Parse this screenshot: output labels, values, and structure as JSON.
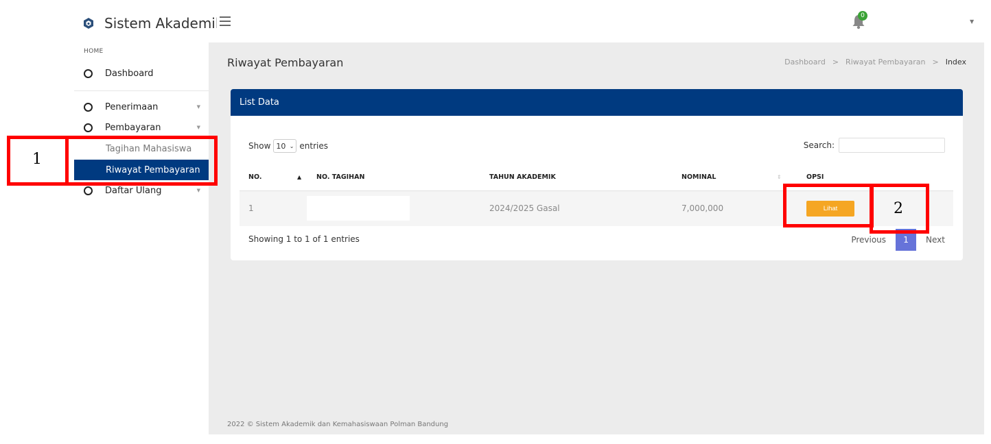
{
  "header": {
    "brand": "Sistem Akademik",
    "notification_count": "0",
    "colors": {
      "brand_blue": "#003a80",
      "badge_green": "#3aa335"
    }
  },
  "sidebar": {
    "section": "HOME",
    "dashboard": "Dashboard",
    "penerimaan": "Penerimaan",
    "pembayaran": "Pembayaran",
    "sub_tagihan": "Tagihan Mahasiswa",
    "sub_riwayat": "Riwayat Pembayaran",
    "daftar_ulang": "Daftar Ulang"
  },
  "page": {
    "title": "Riwayat Pembayaran",
    "breadcrumb": [
      "Dashboard",
      "Riwayat Pembayaran",
      "Index"
    ]
  },
  "card": {
    "title": "List Data",
    "show": "Show",
    "length": "10",
    "entries": "entries",
    "search_label": "Search:",
    "search_value": "",
    "columns": [
      "NO.",
      "NO. TAGIHAN",
      "TAHUN AKADEMIK",
      "NOMINAL",
      "OPSI"
    ],
    "rows": [
      {
        "no": "1",
        "tagihan": "",
        "tahun": "2024/2025 Gasal",
        "nominal": "7,000,000",
        "action": "Lihat"
      }
    ],
    "info": "Showing 1 to 1 of 1 entries",
    "pager": {
      "prev": "Previous",
      "page": "1",
      "next": "Next"
    }
  },
  "footer": "2022 © Sistem Akademik dan Kemahasiswaan Polman Bandung",
  "annotations": {
    "one": "1",
    "two": "2",
    "color": "#ff0000"
  }
}
